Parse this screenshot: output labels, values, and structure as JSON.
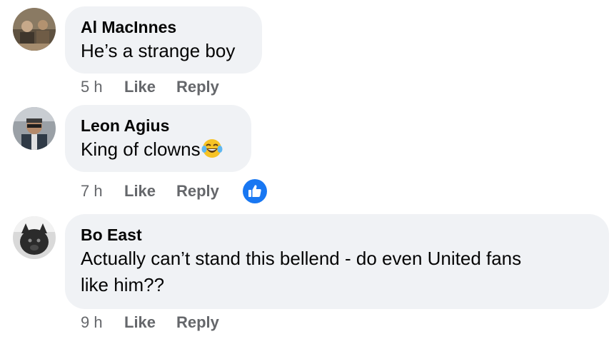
{
  "comments": [
    {
      "author": "Al MacInnes",
      "text": "He’s a strange boy",
      "time": "5 h",
      "like_label": "Like",
      "reply_label": "Reply"
    },
    {
      "author": "Leon Agius",
      "text": "King of clowns",
      "emoji_icon": "face-with-tears-of-joy",
      "time": "7 h",
      "like_label": "Like",
      "reply_label": "Reply",
      "reaction_icon": "like-thumbs-up"
    },
    {
      "author": "Bo East",
      "text_line1": "Actually can’t stand this bellend - do even United fans",
      "text_line2": "like him??",
      "time": "9 h",
      "like_label": "Like",
      "reply_label": "Reply"
    }
  ],
  "colors": {
    "bubble": "#f0f2f5",
    "secondary_text": "#65676b",
    "like_blue": "#1877f2"
  }
}
